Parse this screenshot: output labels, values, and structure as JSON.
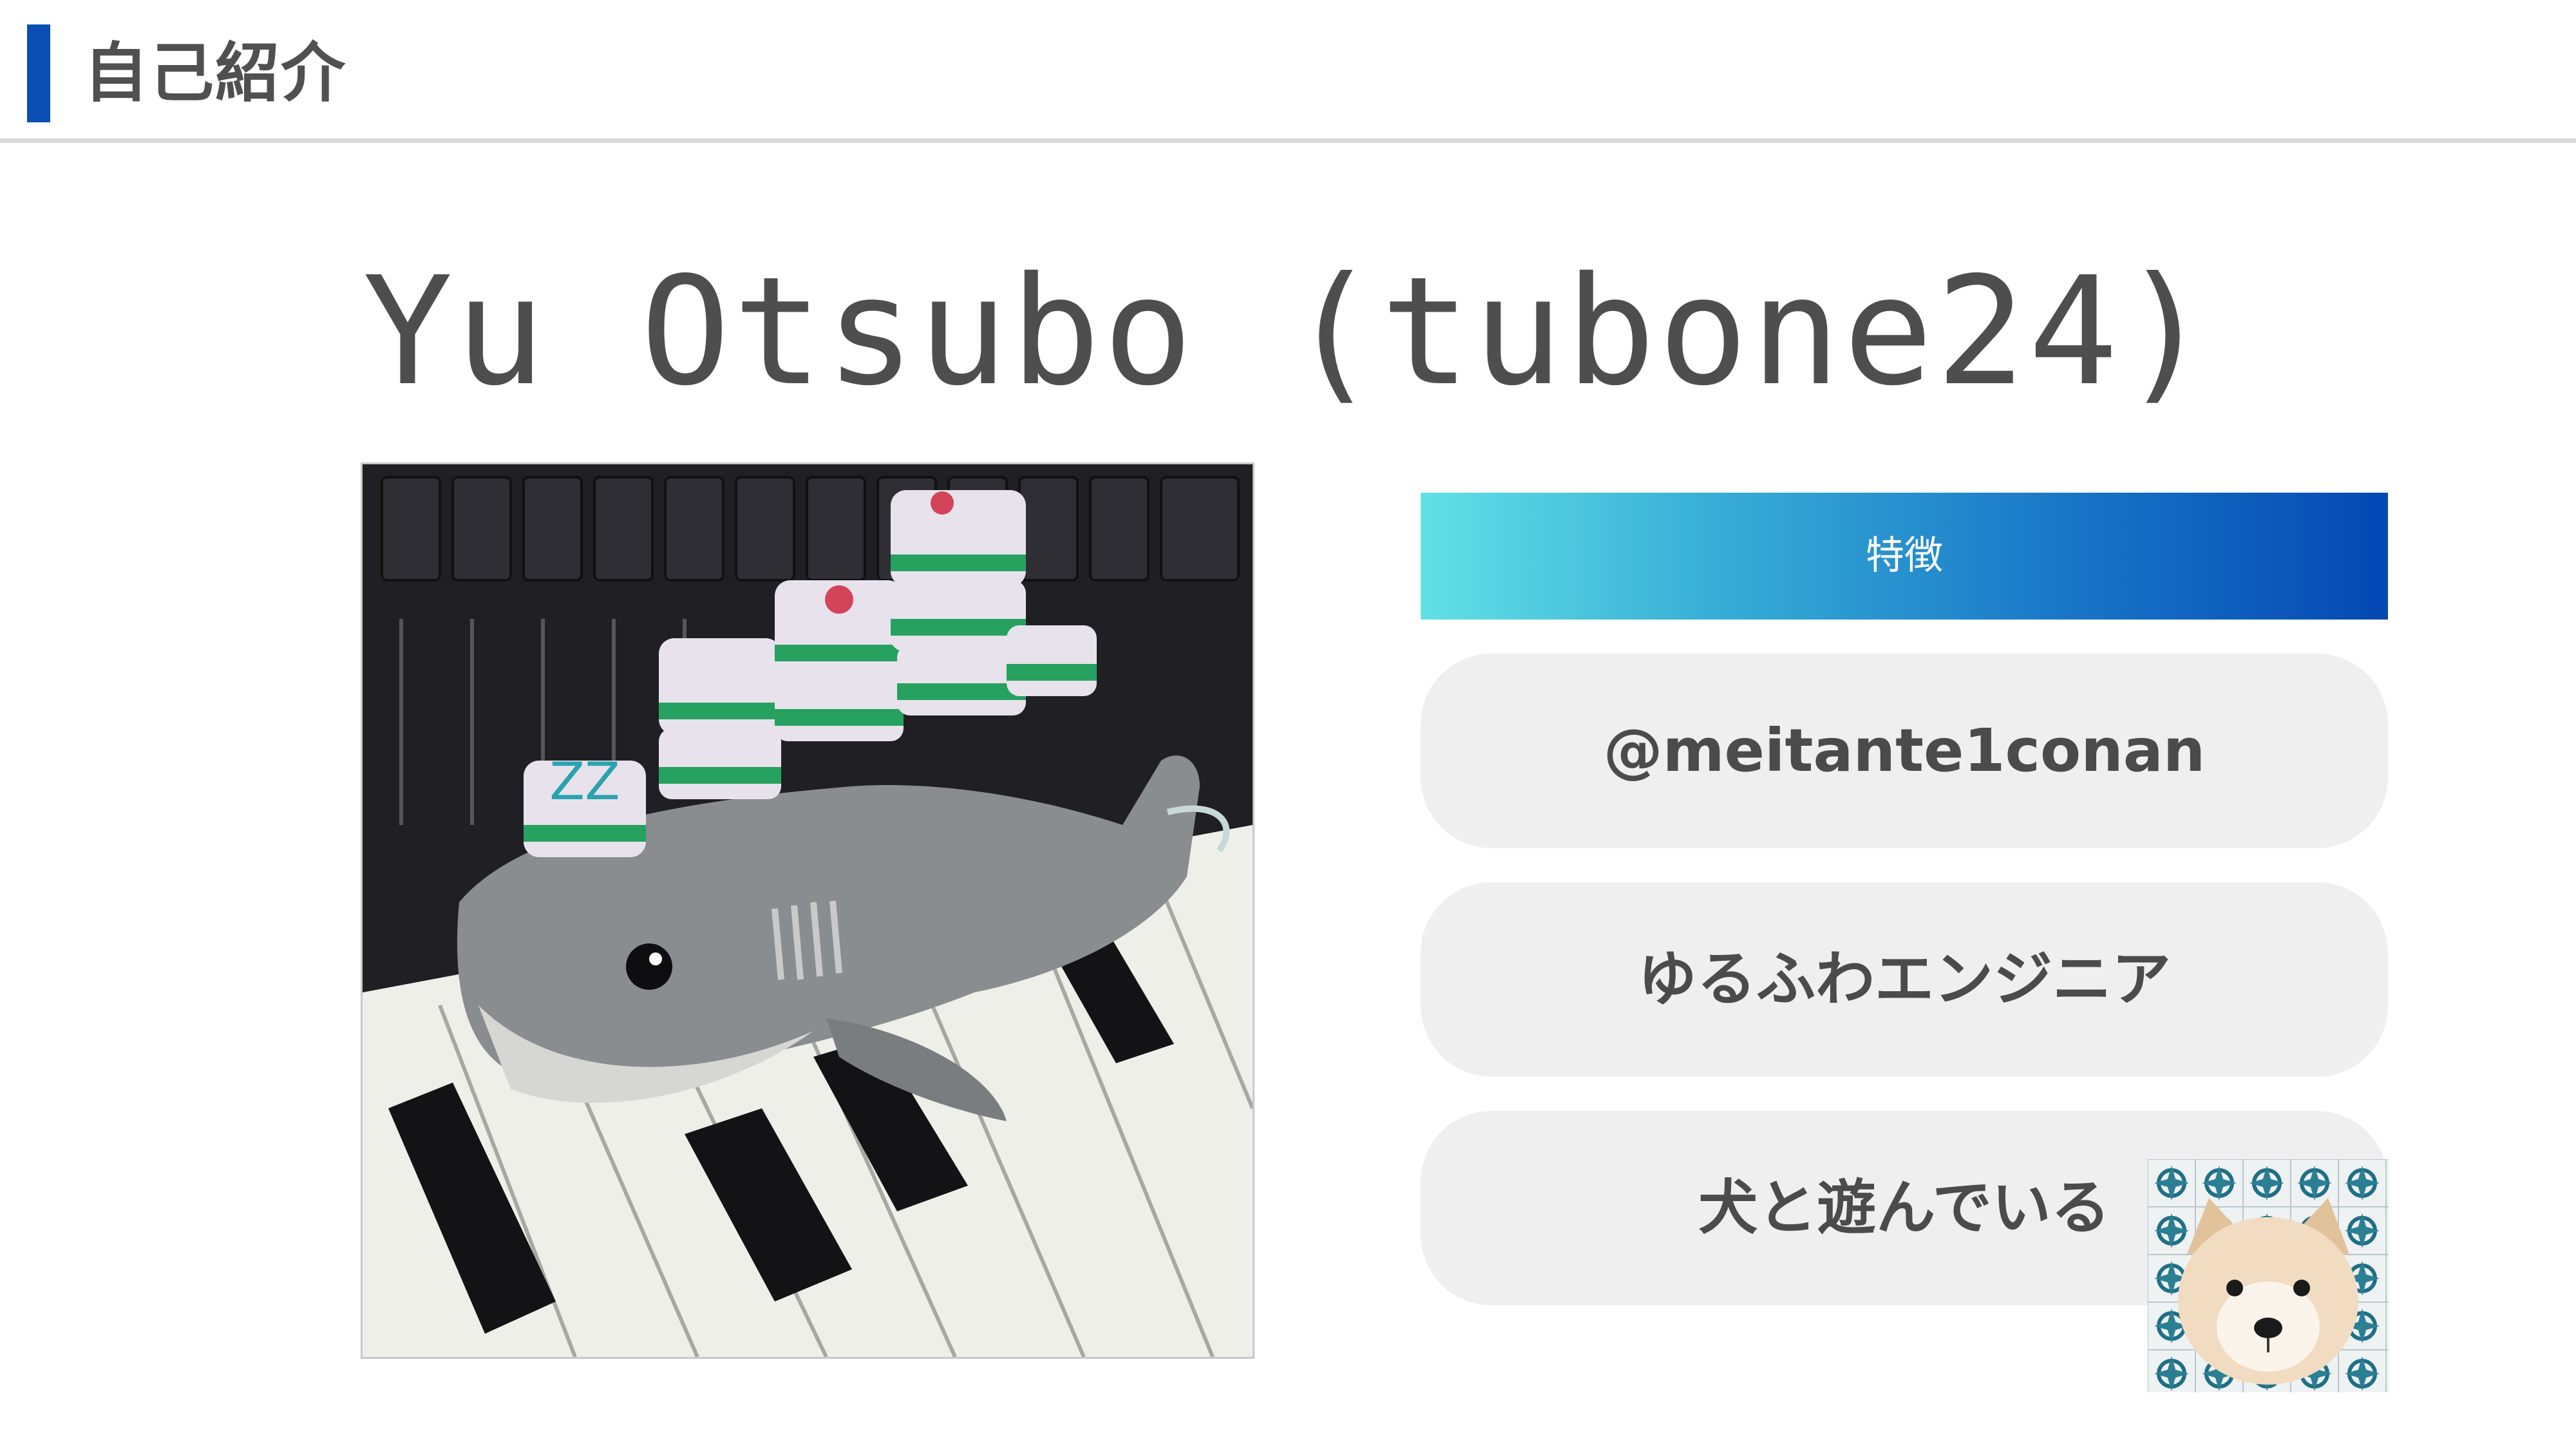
{
  "header": {
    "title": "自己紹介"
  },
  "name": "Yu Otsubo (tubone24)",
  "features": {
    "header": "特徴",
    "items": [
      {
        "label": "@meitante1conan"
      },
      {
        "label": "ゆるふわエンジニア"
      },
      {
        "label": "犬と遊んでいる"
      }
    ]
  },
  "colors": {
    "accent": "#0b4fb5",
    "gradient_start": "#63e0e6",
    "gradient_end": "#0448b3",
    "pill_bg": "#efefef",
    "text": "#4e4e4e"
  },
  "images": {
    "profile_photo": "shark-plush-with-mahjong-tiles-on-piano",
    "dog_photo": "shiba-puppy-on-tiled-background"
  }
}
